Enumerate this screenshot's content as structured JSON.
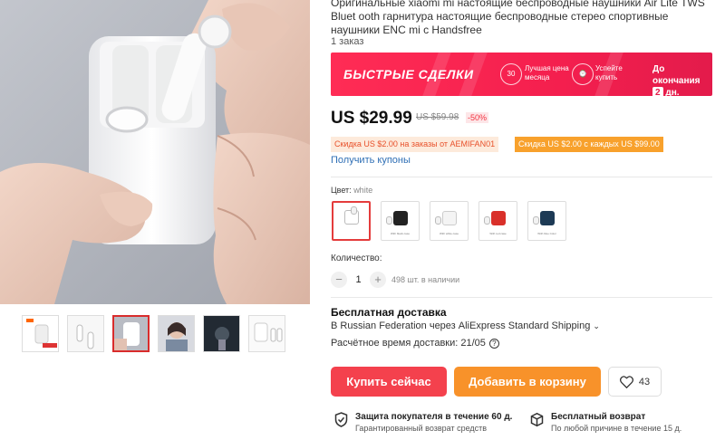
{
  "product": {
    "title": "Оригинальные xiaomi mi настоящие беспроводные наушники Air Lite TWS Bluet ooth гарнитура настоящие беспроводные стерео спортивные наушники ENC mi c Handsfree",
    "orders": "1 заказ"
  },
  "deals_banner": {
    "label": "БЫСТРЫЕ СДЕЛКИ",
    "badge1": "30",
    "text1": "Лучшая цена месяца",
    "text2": "Успейте купить",
    "ends_label": "До окончания",
    "days_value": "2",
    "days_unit": "дн."
  },
  "pricing": {
    "price": "US $29.99",
    "old_price": "US $59.98",
    "discount": "-50%"
  },
  "coupons": {
    "coupon1": "Скидка US $2.00 на заказы от AEMIFAN01",
    "coupon2": "Скидка US $2.00 с каждых US $99.00",
    "get_link": "Получить купоны"
  },
  "color": {
    "label": "Цвет:",
    "selected": "white",
    "options": [
      {
        "caption": "",
        "case_color": "#ffffff"
      },
      {
        "caption": "With black case",
        "case_color": "#222222"
      },
      {
        "caption": "With white case",
        "case_color": "#f4f4f4"
      },
      {
        "caption": "With red case",
        "case_color": "#d9302a"
      },
      {
        "caption": "With blue Color",
        "case_color": "#1d3a55"
      }
    ]
  },
  "quantity": {
    "label": "Количество:",
    "value": "1",
    "minus": "−",
    "plus": "+",
    "stock": "498 шт. в наличии"
  },
  "shipping": {
    "title": "Бесплатная доставка",
    "destination": "В Russian Federation через AliExpress Standard Shipping",
    "eta": "Расчётное время доставки: 21/05",
    "eta_help": "?"
  },
  "actions": {
    "buy_now": "Купить сейчас",
    "add_to_cart": "Добавить в корзину",
    "wishlist_count": "43"
  },
  "guarantees": {
    "g1_title": "Защита покупателя в течение 60 д.",
    "g1_sub": "Гарантированный возврат средств",
    "g2_title": "Бесплатный возврат",
    "g2_sub": "По любой причине в течение 15 д."
  },
  "colors": {
    "accent_red": "#f4414d",
    "accent_orange": "#f8922a",
    "link_blue": "#2f6fb5",
    "deals_pink": "#ff2c55"
  }
}
